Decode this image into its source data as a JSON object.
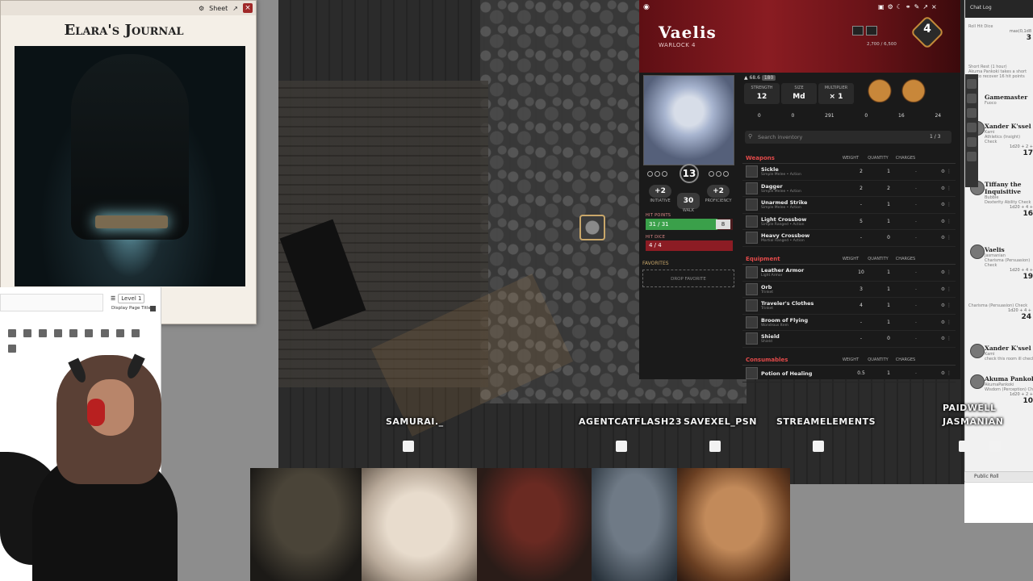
{
  "journal": {
    "sheet_btn": "Sheet",
    "title": "Elara's Journal",
    "editor": {
      "level_select": "Level 1",
      "display_page_title": "Display Page Title"
    }
  },
  "map": {
    "players": [
      {
        "name": "SAMURAI._"
      },
      {
        "name": "AGENTCATFLASH23"
      },
      {
        "name": "SAVEXEL_PSN"
      },
      {
        "name": "STREAMELEMENTS"
      },
      {
        "name": "PAIDWELL"
      },
      {
        "name": "JASMANIAN"
      }
    ]
  },
  "sheet": {
    "name": "Vaelis",
    "class_line": "WARLOCK 4",
    "level": "4",
    "xp": "2,700 / 6,500",
    "armor_class": "13",
    "initiative": "+2",
    "initiative_label": "INITIATIVE",
    "walk": "30",
    "walk_label": "WALK",
    "proficiency": "+2",
    "proficiency_label": "PROFICIENCY",
    "hp_label": "HIT POINTS",
    "hp": "31 / 31",
    "hp_current_fraction": 1.0,
    "temp_hp": "8",
    "hd_label": "HIT DICE",
    "hit_dice": "4 / 4",
    "favorites_label": "FAVORITES",
    "drop_favorite": "DROP FAVORITE",
    "carry": "68.6",
    "carry_max": "180",
    "strength_label": "STRENGTH",
    "strength": "12",
    "size_label": "SIZE",
    "size": "Md",
    "multiplier_label": "MULTIPLIER",
    "multiplier": "× 1",
    "currency": [
      "0",
      "0",
      "291",
      "0",
      "16",
      "24"
    ],
    "search_placeholder": "Search inventory",
    "page": "1 / 3",
    "columns": {
      "weight": "WEIGHT",
      "quantity": "QUANTITY",
      "charges": "CHARGES"
    },
    "weapons_label": "Weapons",
    "weapons": [
      {
        "name": "Sickle",
        "sub": "Simple Melee • Action",
        "weight": "2",
        "qty": "1",
        "charges": "-"
      },
      {
        "name": "Dagger",
        "sub": "Simple Melee • Action",
        "weight": "2",
        "qty": "2",
        "charges": "-"
      },
      {
        "name": "Unarmed Strike",
        "sub": "Simple Melee • Action",
        "weight": "-",
        "qty": "1",
        "charges": "-"
      },
      {
        "name": "Light Crossbow",
        "sub": "Simple Ranged • Action",
        "weight": "5",
        "qty": "1",
        "charges": "-"
      },
      {
        "name": "Heavy Crossbow",
        "sub": "Martial Ranged • Action",
        "weight": "-",
        "qty": "0",
        "charges": "-"
      }
    ],
    "equipment_label": "Equipment",
    "equipment": [
      {
        "name": "Leather Armor",
        "sub": "Light Armor",
        "weight": "10",
        "qty": "1",
        "charges": "-"
      },
      {
        "name": "Orb",
        "sub": "Trinket",
        "weight": "3",
        "qty": "1",
        "charges": "-"
      },
      {
        "name": "Traveler's Clothes",
        "sub": "Trinket",
        "weight": "4",
        "qty": "1",
        "charges": "-"
      },
      {
        "name": "Broom of Flying",
        "sub": "Wondrous Item",
        "weight": "-",
        "qty": "1",
        "charges": "-"
      },
      {
        "name": "Shield",
        "sub": "Shield",
        "weight": "-",
        "qty": "0",
        "charges": "-"
      }
    ],
    "consumables_label": "Consumables",
    "consumables": [
      {
        "name": "Potion of Healing",
        "sub": "",
        "weight": "0.5",
        "qty": "1",
        "charges": "-"
      }
    ]
  },
  "chat": {
    "title": "Chat Log",
    "entries": [
      {
        "line1": "Roll Hit Dice",
        "formula": "max(0,1d8",
        "result": "3"
      },
      {
        "line1": "Short Rest (1 hour)",
        "line2": "Akuma Pankoki takes a short rest to recover 16 hit points"
      },
      {
        "name": "Gamemaster",
        "sub": "Fuoco"
      },
      {
        "name": "Xander K'ssel",
        "sub": "Kami",
        "check": "Athletics (Insight) Check",
        "formula": "1d20 + 2 +",
        "result": "17"
      },
      {
        "name": "Tiffany the Inquisitive",
        "sub": "Bubble",
        "check": "Dexterity Ability Check",
        "formula": "1d20 + 4 +",
        "result": "16"
      },
      {
        "name": "Vaelis",
        "sub": "Jasmanian",
        "check": "Charisma (Persuasion) Check",
        "formula": "1d20 + 4 +",
        "result": "19"
      },
      {
        "check": "Charisma (Persuasion) Check",
        "formula": "1d20 + 4 +",
        "result": "24"
      },
      {
        "name": "Xander K'ssel",
        "sub": "Kami",
        "text": "check this room ill check ov"
      },
      {
        "name": "Akuma Pankoki",
        "sub": "AkumaPankoki",
        "check": "Wisdom (Perception) Check",
        "formula": "1d20 + 2 +",
        "result": "10"
      }
    ],
    "public_roll": "Public Roll"
  }
}
